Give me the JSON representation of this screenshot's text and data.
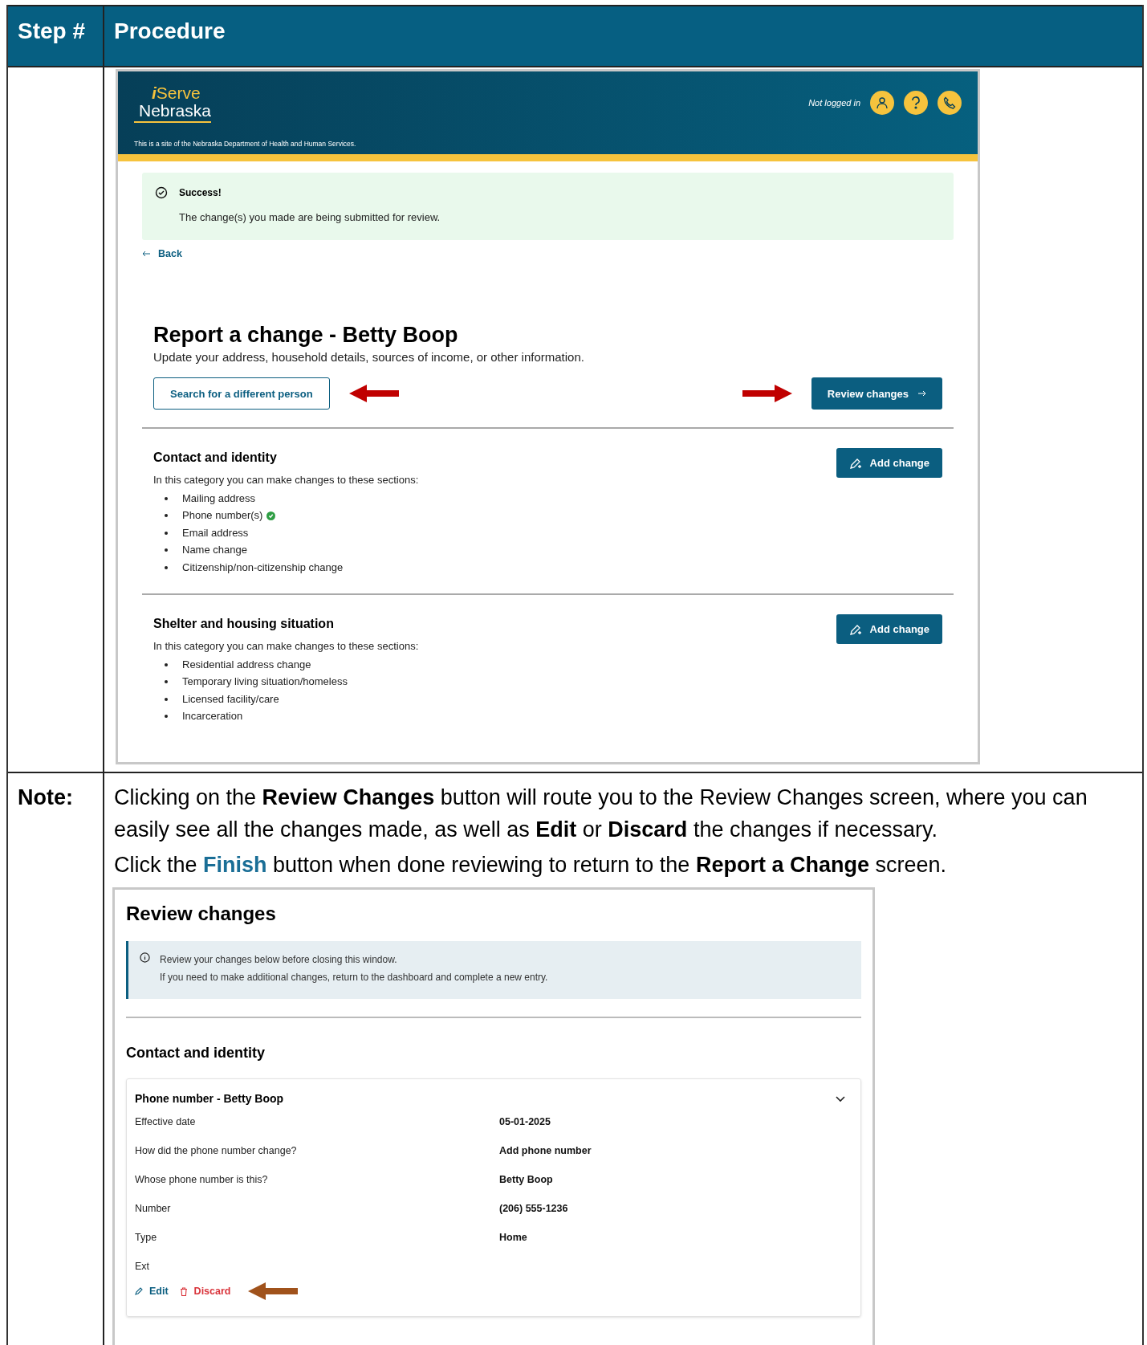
{
  "table": {
    "columns": [
      "Step #",
      "Procedure"
    ]
  },
  "screen1": {
    "logo": {
      "line1": "iServe",
      "line2": "Nebraska"
    },
    "site_notice": "This is a site of the Nebraska Department of Health and Human Services.",
    "login_status": "Not logged in",
    "alert": {
      "title": "Success!",
      "message": "The change(s) you made are being submitted for review."
    },
    "back_link": "Back",
    "title": "Report a change - Betty Boop",
    "subtitle": "Update your address, household details, sources of income, or other information.",
    "search_button": "Search for a different person",
    "review_button": "Review changes",
    "categories": [
      {
        "title": "Contact and identity",
        "intro": "In this category you can make changes to these sections:",
        "button": "Add change",
        "sections": [
          {
            "label": "Mailing address",
            "done": false
          },
          {
            "label": "Phone number(s)",
            "done": true
          },
          {
            "label": "Email address",
            "done": false
          },
          {
            "label": "Name change",
            "done": false
          },
          {
            "label": "Citizenship/non-citizenship change",
            "done": false
          }
        ]
      },
      {
        "title": "Shelter and housing situation",
        "intro": "In this category you can make changes to these sections:",
        "button": "Add change",
        "sections": [
          {
            "label": "Residential address change",
            "done": false
          },
          {
            "label": "Temporary living situation/homeless",
            "done": false
          },
          {
            "label": "Licensed facility/care",
            "done": false
          },
          {
            "label": "Incarceration",
            "done": false
          }
        ]
      }
    ]
  },
  "note": {
    "label": "Note:",
    "paragraphs": [
      [
        {
          "text": "Clicking on the ",
          "kind": "plain"
        },
        {
          "text": "Review Changes",
          "kind": "bold"
        },
        {
          "text": " button will route you to the Review Changes screen, where you can easily see all the changes made, as well as ",
          "kind": "plain"
        },
        {
          "text": "Edit",
          "kind": "bold"
        },
        {
          "text": " or ",
          "kind": "plain"
        },
        {
          "text": "Discard",
          "kind": "bold"
        },
        {
          "text": " the changes if necessary.",
          "kind": "plain"
        }
      ],
      [
        {
          "text": "Click the ",
          "kind": "plain"
        },
        {
          "text": "Finish",
          "kind": "accent"
        },
        {
          "text": " button when done reviewing to return to the ",
          "kind": "plain"
        },
        {
          "text": "Report a Change",
          "kind": "bold"
        },
        {
          "text": " screen.",
          "kind": "plain"
        }
      ]
    ]
  },
  "screen2": {
    "title": "Review changes",
    "info": [
      "Review your changes below before closing this window.",
      "If you need to make additional changes, return to the dashboard and complete a new entry."
    ],
    "section_title": "Contact and identity",
    "card": {
      "title": "Phone number - Betty Boop",
      "expanded": true,
      "rows": [
        {
          "label": "Effective date",
          "value": "05-01-2025"
        },
        {
          "label": "How did the phone number change?",
          "value": "Add phone number"
        },
        {
          "label": "Whose phone number is this?",
          "value": "Betty Boop"
        },
        {
          "label": "Number",
          "value": "(206) 555-1236"
        },
        {
          "label": "Type",
          "value": "Home"
        },
        {
          "label": "Ext"
        }
      ],
      "edit": "Edit",
      "discard": "Discard"
    }
  }
}
